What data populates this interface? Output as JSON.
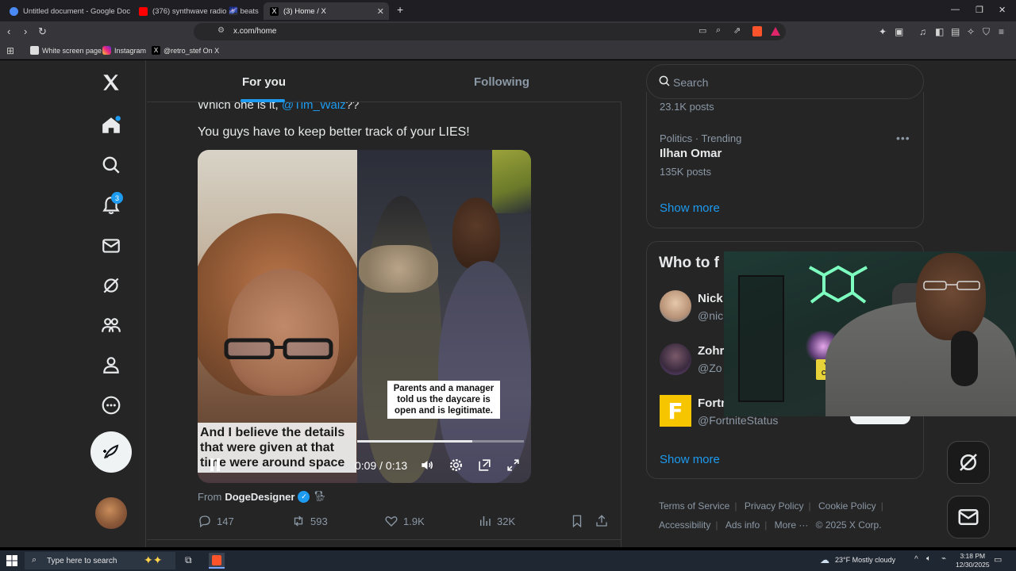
{
  "browser": {
    "tabs": [
      {
        "label": "Untitled document - Google Docs",
        "active": false
      },
      {
        "label": "(376) synthwave radio 🌌 beats t",
        "active": false
      },
      {
        "label": "(3) Home / X",
        "active": true
      }
    ],
    "new_tab": "+",
    "url": "x.com/home",
    "bookmarks": [
      "White screen page",
      "Instagram",
      "@retro_stef On X"
    ],
    "window_controls": [
      "—",
      "❐",
      "✕"
    ]
  },
  "feed": {
    "tabs": [
      {
        "label": "For you",
        "active": true
      },
      {
        "label": "Following",
        "active": false
      }
    ],
    "post": {
      "text_partial": "Which one is it, @Tim_Walz??",
      "text": "You guys have to keep better track of your LIES!",
      "video": {
        "caption_right": "Parents and a manager told us the daycare is open and is legitimate.",
        "caption_left": "And I believe the details that were given at that time were around space",
        "time": "0:09 / 0:13",
        "progress": 0.69
      },
      "from_label": "From",
      "from_user": "DogeDesigner",
      "actions": {
        "replies": "147",
        "reposts": "593",
        "likes": "1.9K",
        "views": "32K"
      }
    }
  },
  "sidebar": {
    "search_placeholder": "Search",
    "trends": {
      "first_posts": "23.1K posts",
      "category": "Politics · Trending",
      "name": "Ilhan Omar",
      "posts": "135K posts",
      "show_more": "Show more"
    },
    "who_to_follow": {
      "title": "Who to f",
      "accounts": [
        {
          "name": "Nick",
          "handle": "@nic"
        },
        {
          "name": "Zohr",
          "handle": "@Zo"
        },
        {
          "name": "Fortn",
          "handle": "@FortniteStatus"
        }
      ],
      "show_more": "Show more"
    },
    "footer": {
      "links": [
        "Terms of Service",
        "Privacy Policy",
        "Cookie Policy",
        "Accessibility",
        "Ads info",
        "More ···"
      ],
      "copyright": "© 2025 X Corp."
    }
  },
  "nav": {
    "notifications_count": "3"
  },
  "webcam": {
    "sign_text": "YES CERS"
  },
  "taskbar": {
    "search_placeholder": "Type here to search",
    "weather": "23°F  Mostly cloudy",
    "time": "3:18 PM",
    "date": "12/30/2025"
  },
  "colors": {
    "accent": "#1d9bf0",
    "background": "#252525",
    "border": "#3a3a3a"
  }
}
